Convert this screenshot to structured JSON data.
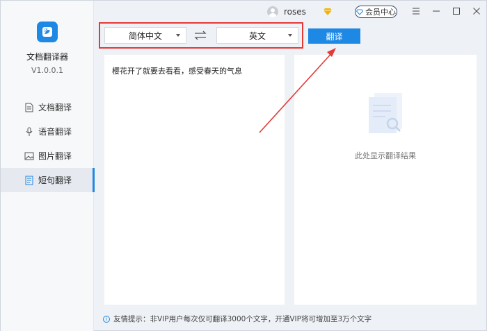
{
  "app": {
    "name": "文档翻译器",
    "version": "V1.0.0.1"
  },
  "nav": [
    {
      "label": "文档翻译",
      "icon": "document-icon",
      "active": false
    },
    {
      "label": "语音翻译",
      "icon": "microphone-icon",
      "active": false
    },
    {
      "label": "图片翻译",
      "icon": "image-icon",
      "active": false
    },
    {
      "label": "短句翻译",
      "icon": "text-lines-icon",
      "active": true
    }
  ],
  "titlebar": {
    "username": "roses",
    "vip_label": "会员中心"
  },
  "toolbar": {
    "source_lang": "简体中文",
    "target_lang": "英文",
    "swap_icon": "⇌",
    "translate_label": "翻译"
  },
  "source": {
    "text": "樱花开了就要去看看，感受春天的气息"
  },
  "result": {
    "placeholder": "此处显示翻译结果"
  },
  "tip": {
    "icon": "i",
    "text": "友情提示：非VIP用户每次仅可翻译3000个文字，开通VIP将可增加至3万个文字"
  },
  "colors": {
    "accent": "#1e88e5",
    "highlight": "#e53935",
    "vip_diamond": "#f5b301"
  }
}
